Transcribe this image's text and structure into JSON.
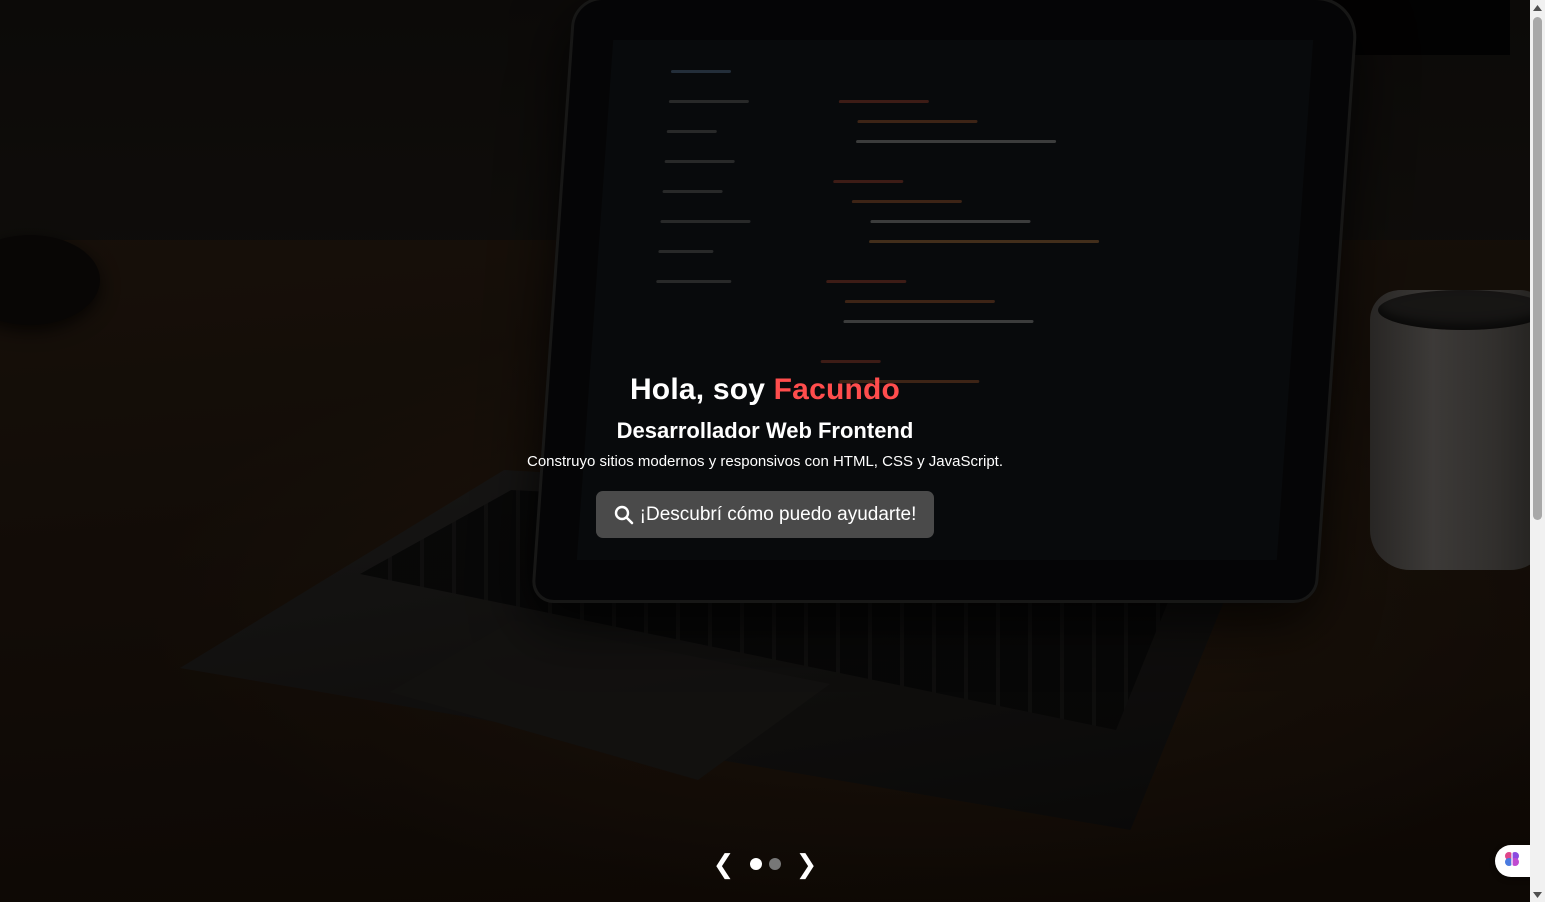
{
  "hero": {
    "title_prefix": "Hola, soy ",
    "title_name": "Facundo",
    "subtitle": "Desarrollador Web Frontend",
    "description": "Construyo sitios modernos y responsivos con HTML, CSS y JavaScript.",
    "cta_label": "¡Descubrí cómo puedo ayudarte!",
    "cta_icon": "search-icon"
  },
  "carousel": {
    "prev_label": "❮",
    "next_label": "❯",
    "slide_count": 2,
    "active_index": 0
  },
  "colors": {
    "accent": "#ff4d4d",
    "cta_background": "#4a4a4a",
    "dot_active": "#ffffff",
    "dot_inactive": "#777777"
  },
  "widget": {
    "icon": "brain-icon"
  }
}
